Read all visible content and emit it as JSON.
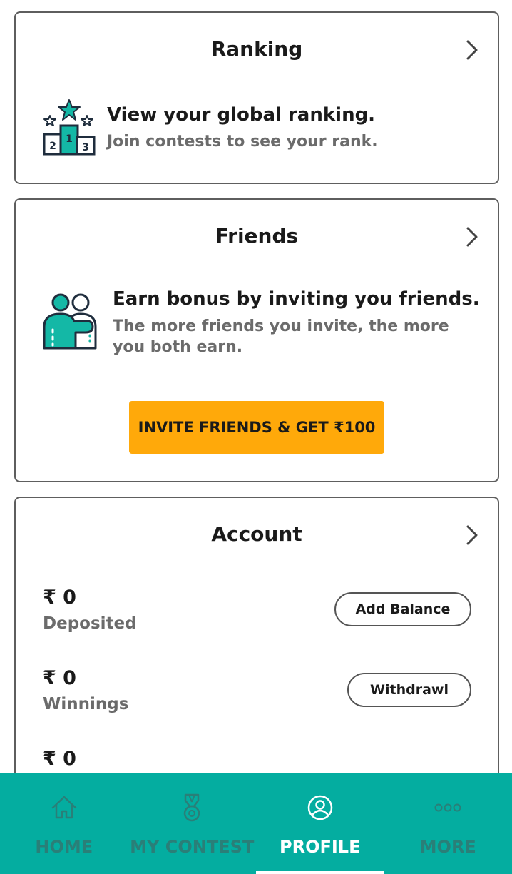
{
  "ranking": {
    "title": "Ranking",
    "heading": "View your global ranking.",
    "subtext": "Join contests to see your rank.",
    "icon": "podium-icon",
    "podium_numbers": [
      "2",
      "1",
      "3"
    ]
  },
  "friends": {
    "title": "Friends",
    "heading": "Earn bonus by inviting you friends.",
    "subtext": "The more friends you invite, the more you both earn.",
    "icon": "friends-icon",
    "invite_button": "INVITE FRIENDS & GET ₹100"
  },
  "account": {
    "title": "Account",
    "rows": [
      {
        "amount": "₹ 0",
        "label": "Deposited",
        "button": "Add Balance"
      },
      {
        "amount": "₹ 0",
        "label": "Winnings",
        "button": "Withdrawl"
      },
      {
        "amount": "₹ 0"
      }
    ]
  },
  "nav": {
    "items": [
      {
        "label": "HOME",
        "icon": "home-icon"
      },
      {
        "label": "MY CONTEST",
        "icon": "medal-icon"
      },
      {
        "label": "PROFILE",
        "icon": "profile-icon",
        "active": true
      },
      {
        "label": "MORE",
        "icon": "more-icon"
      }
    ]
  },
  "colors": {
    "accent": "#04ada0",
    "invite_button": "#ffa90a",
    "icon_teal": "#14b8a6",
    "icon_navy": "#1f2d3d",
    "nav_inactive": "#2a7f78"
  }
}
